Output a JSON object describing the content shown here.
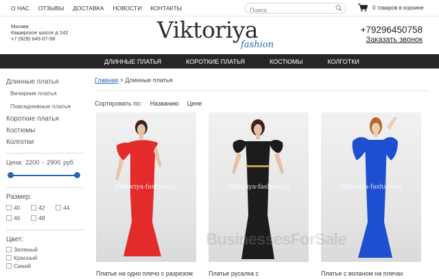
{
  "topnav": [
    "О НАС",
    "ОТЗЫВЫ",
    "ДОСТАВКА",
    "НОВОСТИ",
    "КОНТАКТЫ"
  ],
  "search": {
    "placeholder": "Поиск"
  },
  "cart": {
    "text": "0 товаров в корзине"
  },
  "contacts": {
    "city": "Москва",
    "address": "Каширское шоссе д 142",
    "phone": "+7 (929) 645-07-58"
  },
  "logo": {
    "main": "Viktoriya",
    "sub": "fashion"
  },
  "header": {
    "phone": "+79296450758",
    "callback": "Заказать звонок"
  },
  "mainnav": [
    "ДЛИННЫЕ ПЛАТЬЯ",
    "КОРОТКИЕ ПЛАТЬЯ",
    "КОСТЮМЫ",
    "КОЛГОТКИ"
  ],
  "sidebar": {
    "cat_long": "Длинные платья",
    "sub_evening": "Вечерние платья",
    "sub_casual": "Повседневные платья",
    "cat_short": "Короткие платья",
    "cat_suits": "Костюмы",
    "cat_tights": "Колготки",
    "price_label": "Цена:",
    "price_min": "2200",
    "price_sep": "-",
    "price_max": "2900",
    "price_unit": "руб",
    "size_label": "Размер:",
    "sizes": [
      "40",
      "42",
      "44",
      "46",
      "48"
    ],
    "color_label": "Цвет:",
    "colors": [
      "Зеленый",
      "Красный",
      "Синий"
    ]
  },
  "breadcrumb": {
    "home": "Главная",
    "sep": " > ",
    "current": "Длинные платья"
  },
  "sort": {
    "label": "Сортировать по:",
    "by_name": "Названию",
    "by_price": "Цене"
  },
  "products": [
    {
      "title": "Платье на одно плечо с разрезом",
      "watermark": "Viktoriya-fashion.ru",
      "color": "#e32b2b"
    },
    {
      "title": "Платье русалка с",
      "watermark": "Viktoriya-fashion.ru",
      "color": "#1c1c1c"
    },
    {
      "title": "Платье с воланом на плечах",
      "watermark": "Viktoriya-fashion.ru",
      "color": "#1f4fd1"
    }
  ],
  "overlay_watermark": "BusinessesForSale"
}
